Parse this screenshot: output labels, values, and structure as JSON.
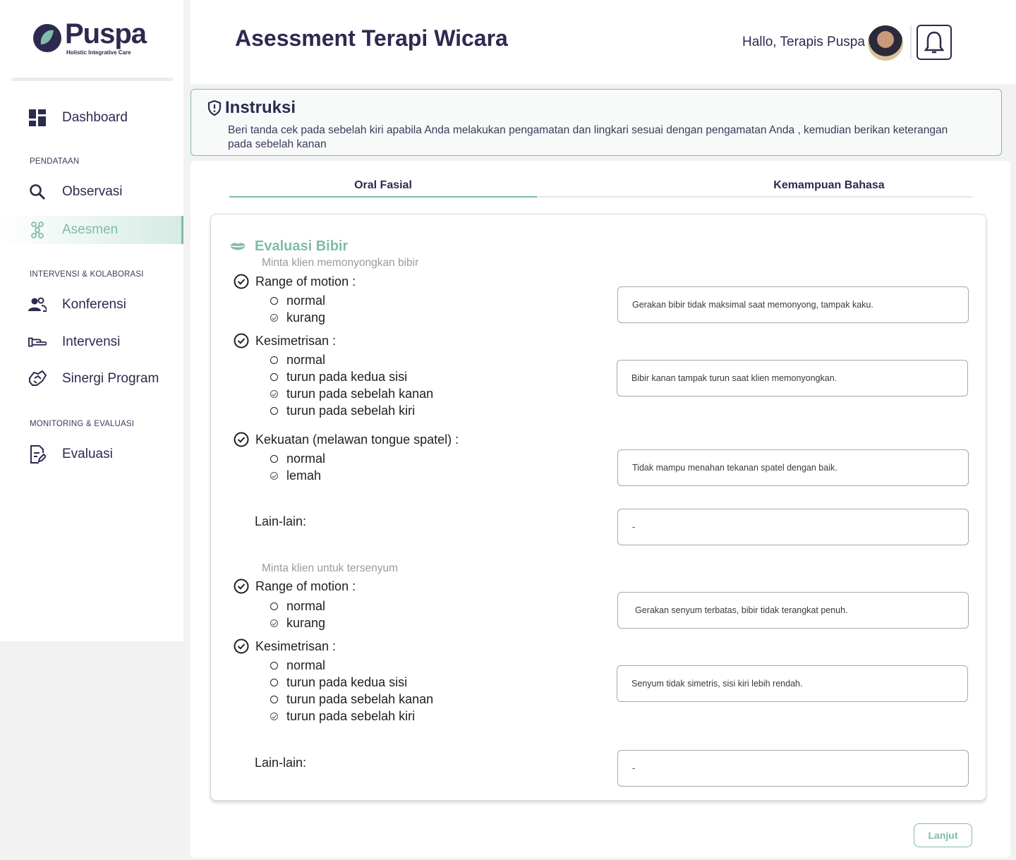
{
  "brand": {
    "name": "Puspa",
    "tagline": "Holistic Integrative Care",
    "accent": "#7fbcaa",
    "primary": "#2d2a4f"
  },
  "sidebar": {
    "dashboard": {
      "label": "Dashboard",
      "icon": "dashboard-icon"
    },
    "sections": [
      "PENDATAAN",
      "INTERVENSI & KOLABORASI",
      "MONITORING & EVALUASI"
    ],
    "items": [
      {
        "label": "Observasi",
        "icon": "search-icon"
      },
      {
        "label": "Asesmen",
        "icon": "molecule-icon",
        "active": true
      },
      {
        "label": "Konferensi",
        "icon": "people-icon"
      },
      {
        "label": "Intervensi",
        "icon": "hand-icon"
      },
      {
        "label": "Sinergi Program",
        "icon": "handshake-icon"
      },
      {
        "label": "Evaluasi",
        "icon": "edit-document-icon"
      }
    ]
  },
  "header": {
    "title": "Asessment Terapi Wicara",
    "greeting": "Hallo, Terapis Puspa"
  },
  "instruksi": {
    "title": "Instruksi",
    "text": "Beri tanda cek pada sebelah kiri apabila Anda melakukan pengamatan dan lingkari sesuai dengan pengamatan Anda , kemudian berikan keterangan pada sebelah kanan"
  },
  "tabs": [
    "Oral Fasial",
    "Kemampuan Bahasa"
  ],
  "evaluasi": {
    "title": "Evaluasi Bibir",
    "hint1": "Minta klien memonyongkan bibir",
    "hint2": "Minta klien untuk tersenyum",
    "q1": {
      "label": "Range of motion :",
      "options": [
        "normal",
        "kurang"
      ],
      "selected": 1,
      "note": "Gerakan bibir tidak maksimal saat memonyong, tampak kaku."
    },
    "q2": {
      "label": "Kesimetrisan :",
      "options": [
        "normal",
        "turun pada kedua sisi",
        "turun pada sebelah kanan",
        "turun pada sebelah kiri"
      ],
      "selected": 2,
      "note": "Bibir kanan tampak turun saat klien memonyongkan."
    },
    "q3": {
      "label": "Kekuatan (melawan tongue spatel) :",
      "options": [
        "normal",
        "lemah"
      ],
      "selected": 1,
      "note": "Tidak mampu menahan tekanan spatel dengan baik."
    },
    "lain1": {
      "label": "Lain-lain:",
      "note": "-"
    },
    "q4": {
      "label": "Range of motion :",
      "options": [
        "normal",
        "kurang"
      ],
      "selected": 1,
      "note": "Gerakan senyum terbatas, bibir tidak terangkat penuh."
    },
    "q5": {
      "label": "Kesimetrisan :",
      "options": [
        "normal",
        "turun pada kedua sisi",
        "turun pada sebelah kanan",
        "turun pada sebelah kiri"
      ],
      "selected": 3,
      "note": "Senyum tidak simetris, sisi kiri lebih rendah."
    },
    "lain2": {
      "label": "Lain-lain:",
      "note": "-"
    }
  },
  "lanjut_label": "Lanjut"
}
